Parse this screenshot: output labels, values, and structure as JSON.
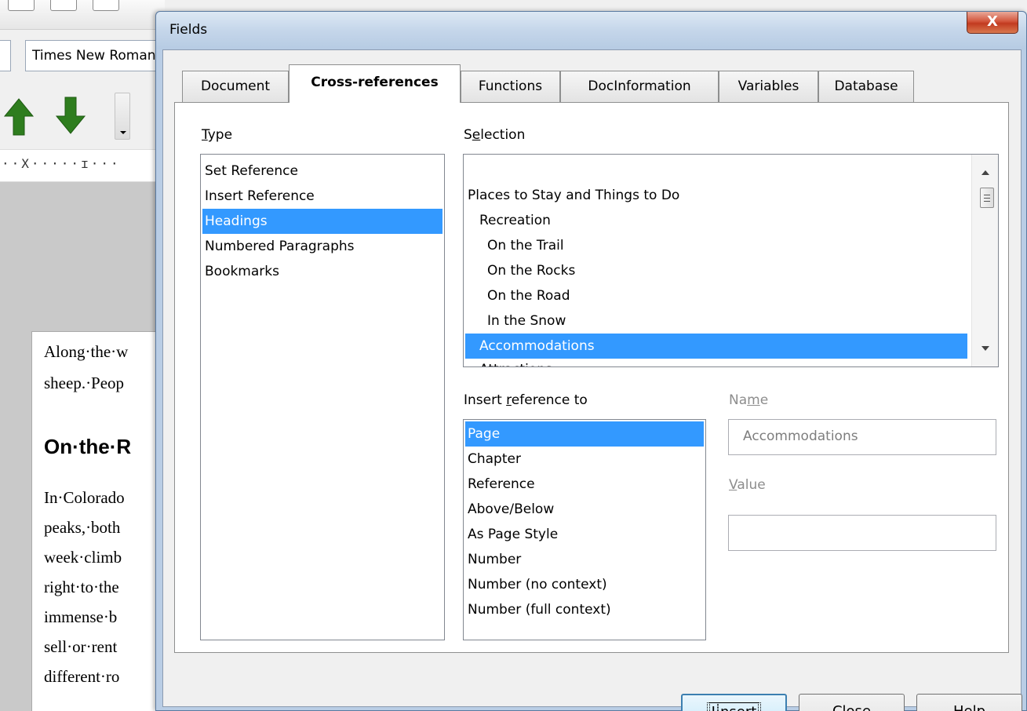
{
  "background": {
    "font_name": "Times New Roman",
    "ruler_text": "··X·····ɪ···",
    "doc_lines": [
      "Along·the·w",
      "sheep.·Peop",
      "In·Colorado",
      "peaks,·both",
      "week·climb",
      "right·to·the",
      "immense·b",
      "sell·or·rent",
      "different·ro"
    ],
    "doc_heading": "On·the·R",
    "arrow_up_color": "#2e7d1e",
    "arrow_down_color": "#2e7d1e"
  },
  "dialog": {
    "title": "Fields",
    "close_label": "X",
    "tabs": [
      {
        "label": "Document"
      },
      {
        "label": "Cross-references"
      },
      {
        "label": "Functions"
      },
      {
        "label": "DocInformation"
      },
      {
        "label": "Variables"
      },
      {
        "label": "Database"
      }
    ],
    "active_tab": "Cross-references",
    "type": {
      "label_first": "T",
      "label_rest": "ype",
      "items": [
        "Set Reference",
        "Insert Reference",
        "Headings",
        "Numbered Paragraphs",
        "Bookmarks"
      ],
      "selected": "Headings"
    },
    "selection": {
      "label_first": "S",
      "label_mid": "e",
      "label_rest": "lection",
      "items": [
        "Places to Stay and Things to Do",
        "Recreation",
        "On the Trail",
        "On the Rocks",
        "On the Road",
        "In the Snow",
        "Accommodations",
        "Attractions"
      ],
      "selected": "Accommodations"
    },
    "insert_reference_to": {
      "label_a": "Insert ",
      "label_u": "r",
      "label_b": "eference to",
      "items": [
        "Page",
        "Chapter",
        "Reference",
        "Above/Below",
        "As Page Style",
        "Number",
        "Number (no context)",
        "Number (full context)"
      ],
      "selected": "Page"
    },
    "name": {
      "label_a": "Na",
      "label_u": "m",
      "label_b": "e",
      "value": "Accommodations"
    },
    "value_field": {
      "label_u": "V",
      "label_b": "alue",
      "value": ""
    },
    "buttons": {
      "insert_u": "I",
      "insert_rest": "nsert",
      "close_u": "C",
      "close_rest": "lose",
      "help_u": "H",
      "help_rest": "elp"
    },
    "accent_color": "#3399ff"
  }
}
